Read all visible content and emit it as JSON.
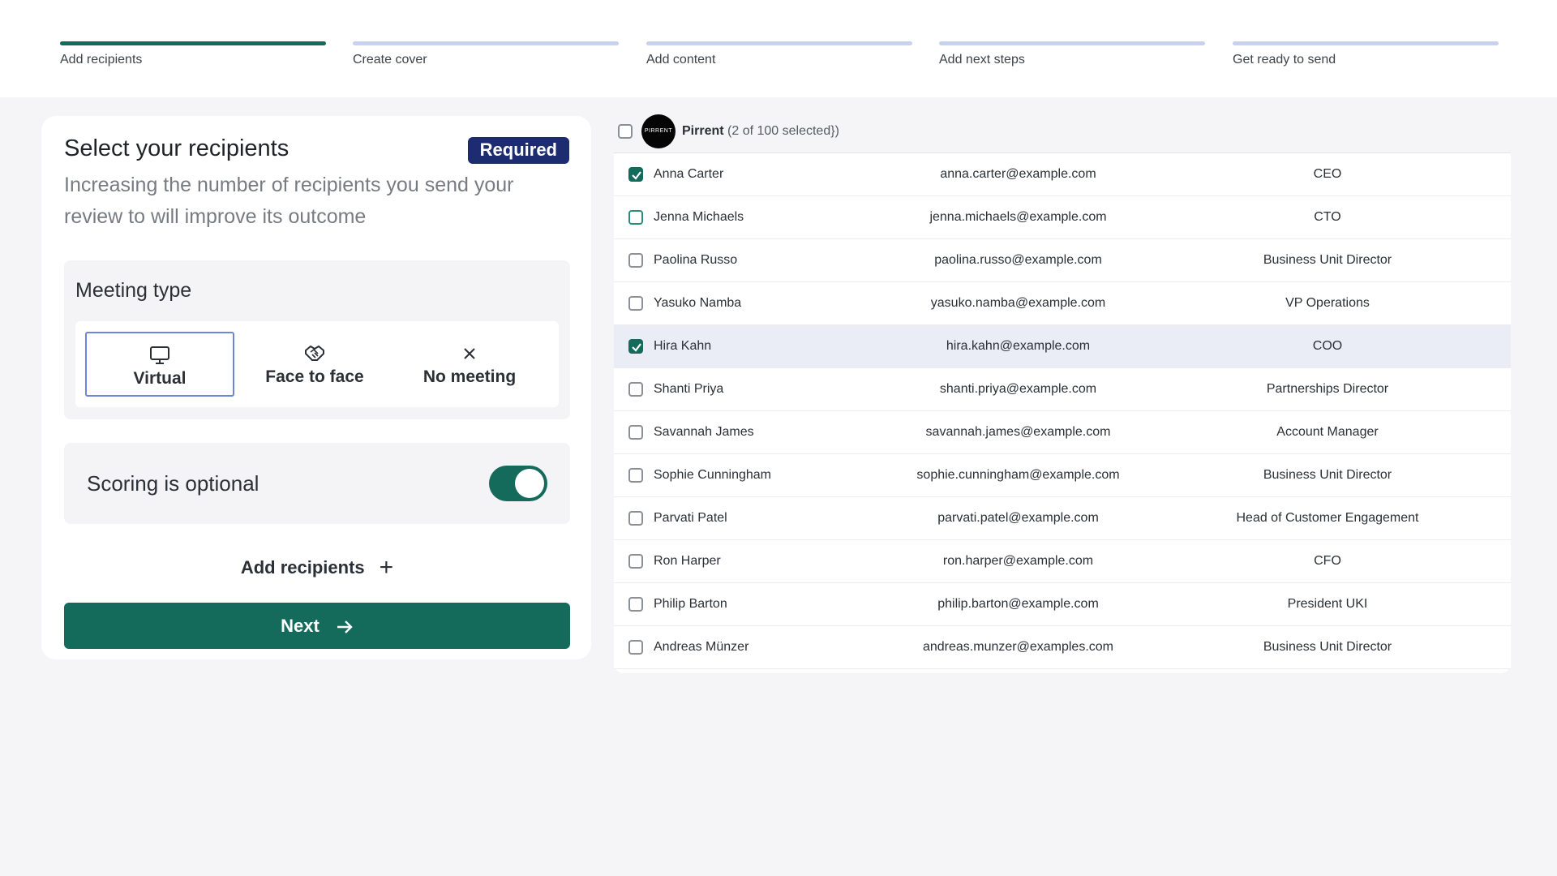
{
  "stepper": {
    "steps": [
      {
        "label": "Add recipients",
        "active": true
      },
      {
        "label": "Create cover",
        "active": false
      },
      {
        "label": "Add content",
        "active": false
      },
      {
        "label": "Add next steps",
        "active": false
      },
      {
        "label": "Get ready to send",
        "active": false
      }
    ]
  },
  "recipients_card": {
    "title": "Select your recipients",
    "badge": "Required",
    "description": "Increasing the number of recipients you send your review to will improve its outcome",
    "meeting": {
      "title": "Meeting type",
      "options": [
        {
          "label": "Virtual",
          "icon": "monitor-icon",
          "selected": true
        },
        {
          "label": "Face to face",
          "icon": "handshake-icon",
          "selected": false
        },
        {
          "label": "No meeting",
          "icon": "close-icon",
          "selected": false
        }
      ]
    },
    "scoring": {
      "label": "Scoring is optional",
      "enabled": true
    },
    "add_recipients_label": "Add recipients",
    "next_label": "Next"
  },
  "table": {
    "org_name": "Pirrent",
    "avatar_text": "PIRRENT",
    "selection_text": "(2 of 100 selected})",
    "rows": [
      {
        "name": "Anna Carter",
        "email": "anna.carter@example.com",
        "role": "CEO",
        "checked": true
      },
      {
        "name": "Jenna Michaels",
        "email": "jenna.michaels@example.com",
        "role": "CTO",
        "checked": false
      },
      {
        "name": "Paolina Russo",
        "email": "paolina.russo@example.com",
        "role": "Business Unit Director",
        "checked": false
      },
      {
        "name": "Yasuko Namba",
        "email": "yasuko.namba@example.com",
        "role": "VP Operations",
        "checked": false
      },
      {
        "name": "Hira Kahn",
        "email": "hira.kahn@example.com",
        "role": "COO",
        "checked": true
      },
      {
        "name": "Shanti Priya",
        "email": "shanti.priya@example.com",
        "role": "Partnerships Director",
        "checked": false
      },
      {
        "name": "Savannah James",
        "email": "savannah.james@example.com",
        "role": "Account Manager",
        "checked": false
      },
      {
        "name": "Sophie Cunningham",
        "email": "sophie.cunningham@example.com",
        "role": "Business Unit Director",
        "checked": false
      },
      {
        "name": "Parvati Patel",
        "email": "parvati.patel@example.com",
        "role": "Head of Customer Engagement",
        "checked": false
      },
      {
        "name": "Ron Harper",
        "email": "ron.harper@example.com",
        "role": "CFO",
        "checked": false
      },
      {
        "name": "Philip Barton",
        "email": "philip.barton@example.com",
        "role": "President UKI",
        "checked": false
      },
      {
        "name": "Andreas Münzer",
        "email": "andreas.munzer@examples.com",
        "role": "Business Unit Director",
        "checked": false
      }
    ]
  },
  "colors": {
    "primary": "#146b5b",
    "badge": "#1d2c70",
    "inactive_step": "#c9d1f1",
    "highlight_row": "#eaedf6"
  }
}
